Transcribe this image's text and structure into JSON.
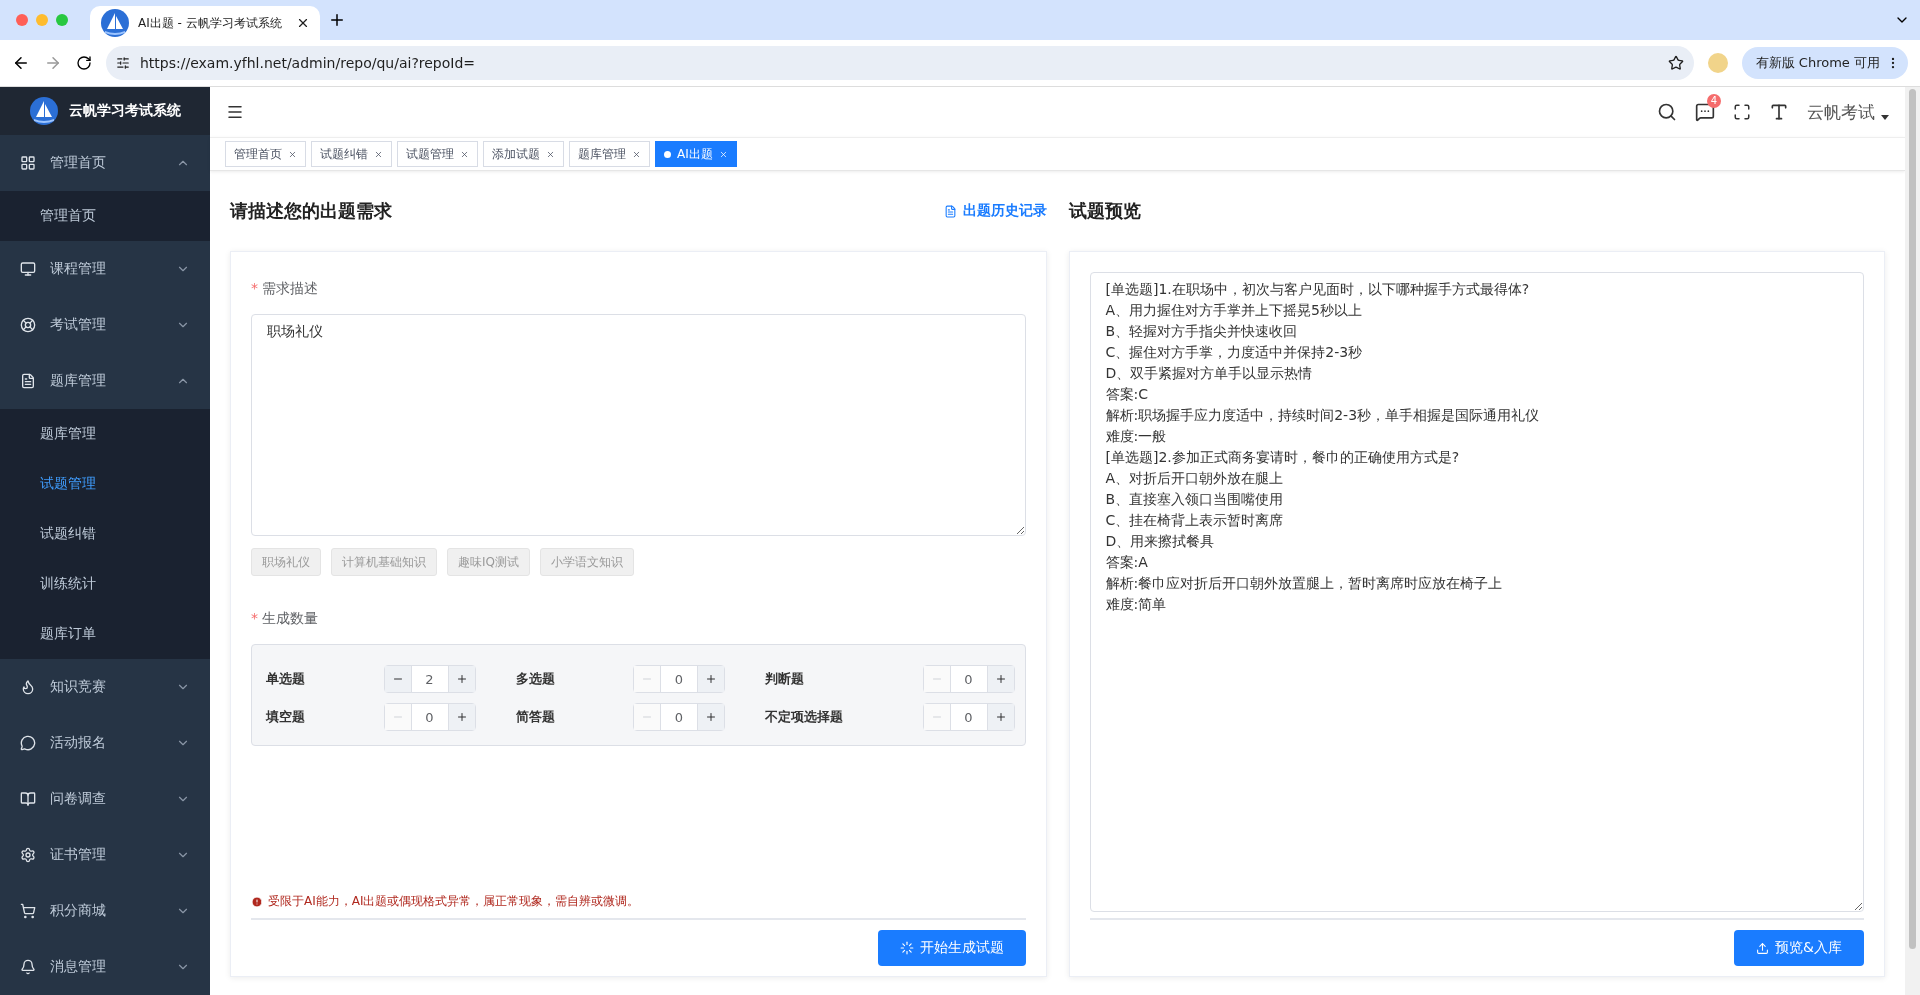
{
  "browser": {
    "tab_title": "AI出题 - 云帆学习考试系统",
    "url": "https://exam.yfhl.net/admin/repo/qu/ai?repoId=",
    "update_button": "有新版 Chrome 可用"
  },
  "sidebar": {
    "brand": "云帆学习考试系统",
    "items": [
      {
        "label": "管理首页",
        "expanded": true,
        "children": [
          {
            "label": "管理首页",
            "selected": false
          }
        ]
      },
      {
        "label": "课程管理",
        "expanded": false
      },
      {
        "label": "考试管理",
        "expanded": false
      },
      {
        "label": "题库管理",
        "expanded": true,
        "children": [
          {
            "label": "题库管理",
            "selected": false
          },
          {
            "label": "试题管理",
            "selected": true
          },
          {
            "label": "试题纠错",
            "selected": false
          },
          {
            "label": "训练统计",
            "selected": false
          },
          {
            "label": "题库订单",
            "selected": false
          }
        ]
      },
      {
        "label": "知识竞赛",
        "expanded": false
      },
      {
        "label": "活动报名",
        "expanded": false
      },
      {
        "label": "问卷调查",
        "expanded": false
      },
      {
        "label": "证书管理",
        "expanded": false
      },
      {
        "label": "积分商城",
        "expanded": false
      },
      {
        "label": "消息管理",
        "expanded": false
      }
    ]
  },
  "header": {
    "notification_count": "4",
    "user": "云帆考试"
  },
  "tabs": [
    {
      "label": "管理首页",
      "selected": false
    },
    {
      "label": "试题纠错",
      "selected": false
    },
    {
      "label": "试题管理",
      "selected": false
    },
    {
      "label": "添加试题",
      "selected": false
    },
    {
      "label": "题库管理",
      "selected": false
    },
    {
      "label": "AI出题",
      "selected": true
    }
  ],
  "left": {
    "title": "请描述您的出题需求",
    "history_link": "出题历史记录",
    "description_required_mark": "*",
    "description_label": "需求描述",
    "description": "职场礼仪",
    "presets": [
      "职场礼仪",
      "计算机基础知识",
      "趣味IQ测试",
      "小学语文知识"
    ],
    "count_required_mark": "*",
    "count_label": "生成数量",
    "counts": [
      {
        "label": "单选题",
        "value": "2",
        "minus_disabled": false
      },
      {
        "label": "多选题",
        "value": "0",
        "minus_disabled": true
      },
      {
        "label": "判断题",
        "value": "0",
        "minus_disabled": true
      },
      {
        "label": "填空题",
        "value": "0",
        "minus_disabled": true
      },
      {
        "label": "简答题",
        "value": "0",
        "minus_disabled": true
      },
      {
        "label": "不定项选择题",
        "value": "0",
        "minus_disabled": true
      }
    ],
    "notice": "受限于AI能力，AI出题或偶现格式异常，属正常现象，需自辨或微调。",
    "generate_button": "开始生成试题"
  },
  "right": {
    "title": "试题预览",
    "lines": [
      "[单选题]1.在职场中，初次与客户见面时，以下哪种握手方式最得体?",
      "A、用力握住对方手掌并上下摇晃5秒以上",
      "B、轻握对方手指尖并快速收回",
      "C、握住对方手掌，力度适中并保持2-3秒",
      "D、双手紧握对方单手以显示热情",
      "答案:C",
      "解析:职场握手应力度适中，持续时间2-3秒，单手相握是国际通用礼仪",
      "难度:一般",
      "[单选题]2.参加正式商务宴请时，餐巾的正确使用方式是?",
      "A、对折后开口朝外放在腿上",
      "B、直接塞入领口当围嘴使用",
      "C、挂在椅背上表示暂时离席",
      "D、用来擦拭餐具",
      "答案:A",
      "解析:餐巾应对折后开口朝外放置腿上，暂时离席时应放在椅子上",
      "难度:简单"
    ],
    "save_button": "预览&入库"
  }
}
